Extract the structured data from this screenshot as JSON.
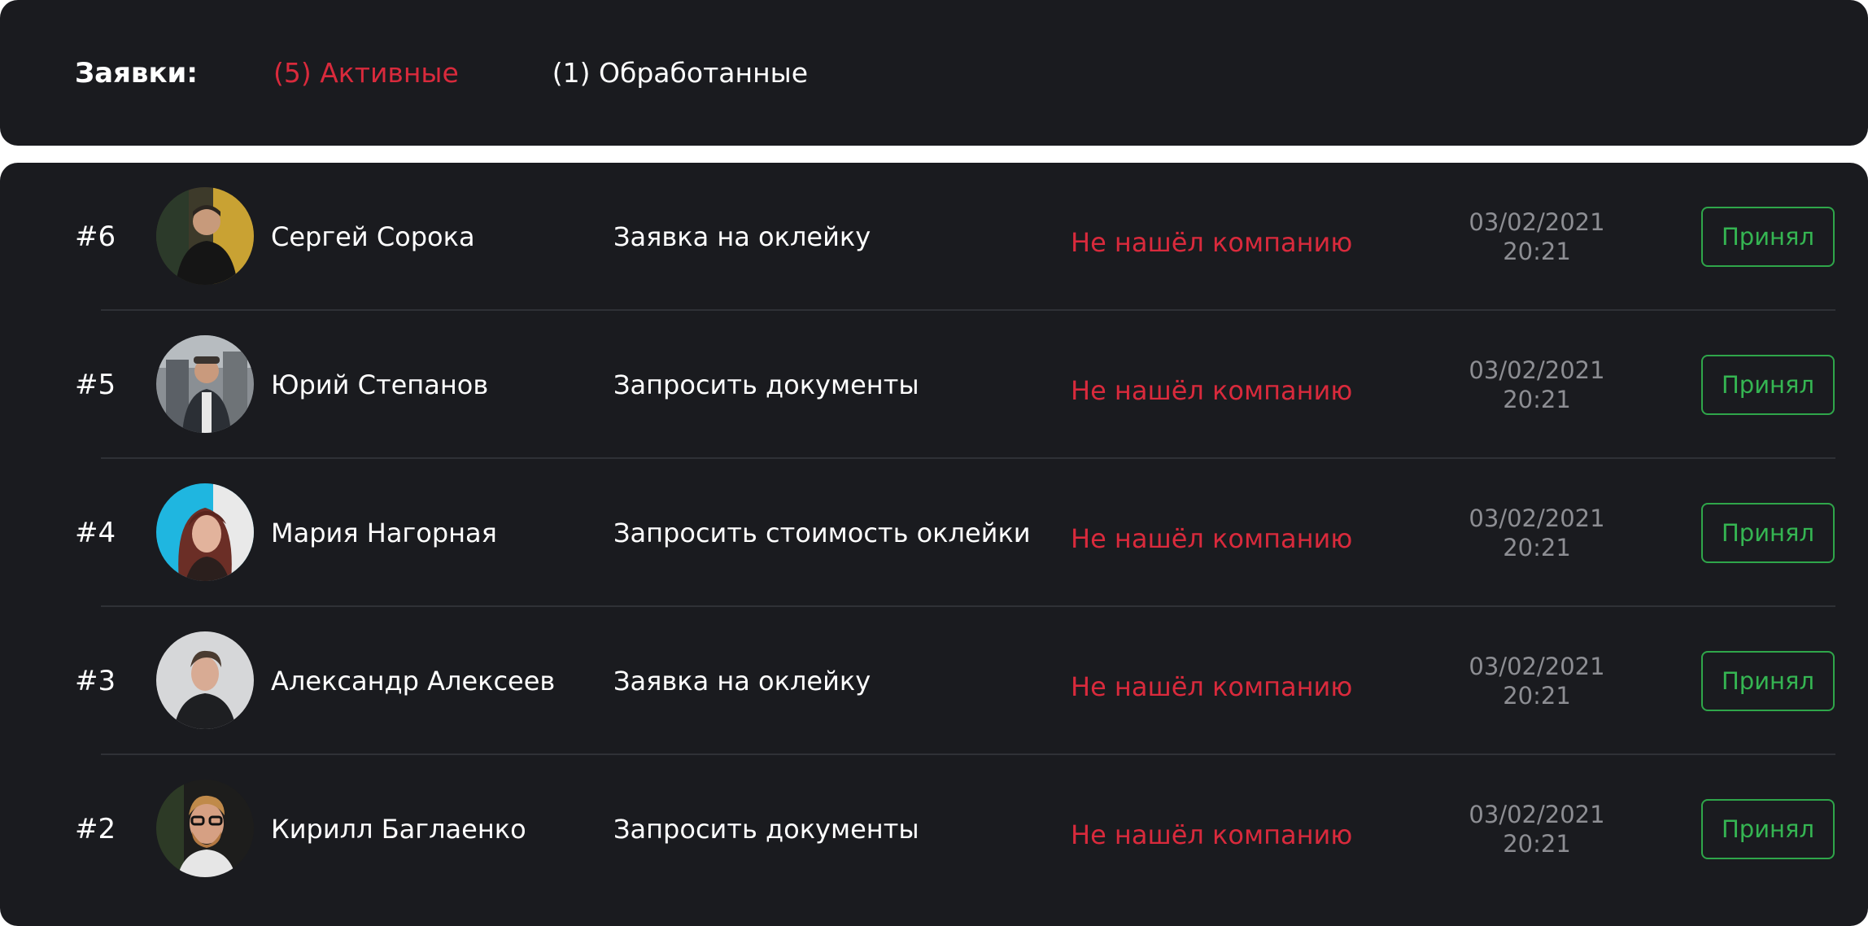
{
  "header": {
    "title": "Заявки:",
    "tabs": [
      {
        "label": "(5) Активные",
        "active": true
      },
      {
        "label": "(1) Обработанные",
        "active": false
      }
    ]
  },
  "requests": [
    {
      "number": "#6",
      "name": "Сергей Сорока",
      "subject": "Заявка на оклейку",
      "status": "Не нашёл компанию",
      "date": "03/02/2021",
      "time": "20:21",
      "action": "Принял"
    },
    {
      "number": "#5",
      "name": "Юрий Степанов",
      "subject": "Запросить документы",
      "status": "Не нашёл компанию",
      "date": "03/02/2021",
      "time": "20:21",
      "action": "Принял"
    },
    {
      "number": "#4",
      "name": "Мария Нагорная",
      "subject": "Запросить стоимость оклейки",
      "status": "Не нашёл компанию",
      "date": "03/02/2021",
      "time": "20:21",
      "action": "Принял"
    },
    {
      "number": "#3",
      "name": "Александр Алексеев",
      "subject": "Заявка на оклейку",
      "status": "Не нашёл компанию",
      "date": "03/02/2021",
      "time": "20:21",
      "action": "Принял"
    },
    {
      "number": "#2",
      "name": "Кирилл Баглаенко",
      "subject": "Запросить документы",
      "status": "Не нашёл компанию",
      "date": "03/02/2021",
      "time": "20:21",
      "action": "Принял"
    }
  ],
  "colors": {
    "panel_bg": "#1a1b1f",
    "accent_red": "#d92a3c",
    "accent_green": "#35b552",
    "muted_text": "#8d8e93"
  }
}
